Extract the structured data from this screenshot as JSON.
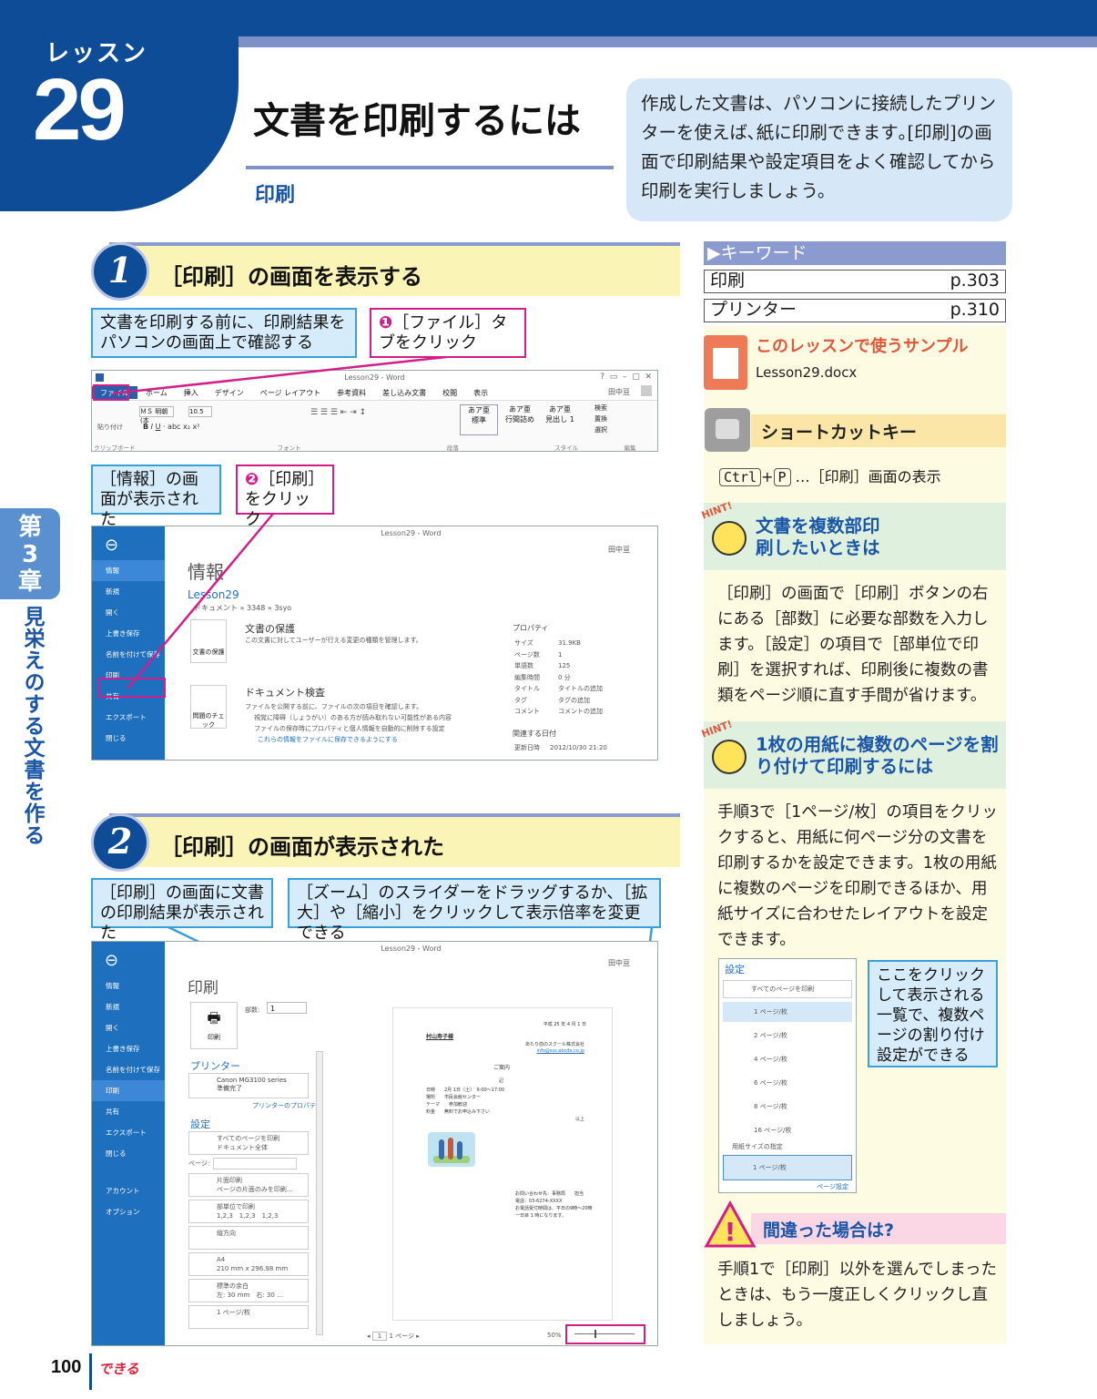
{
  "header": {
    "lesson_label": "レッスン",
    "lesson_number": "29",
    "title": "文書を印刷するには",
    "subtitle": "印刷",
    "intro": "作成した文書は、パソコンに接続したプリンターを使えば､紙に印刷できます｡[印刷]の画面で印刷結果や設定項目をよく確認してから印刷を実行しましょう。"
  },
  "chapter": {
    "tab_line1": "第",
    "tab_line2": "3",
    "tab_line3": "章",
    "title": "見栄えのする文書を作る"
  },
  "step1": {
    "number": "1",
    "title": "［印刷］の画面を表示する",
    "callout_a": "文書を印刷する前に、印刷結果をパソコンの画面上で確認する",
    "callout_b_num": "❶",
    "callout_b": "［ファイル］タブをクリック",
    "callout_c": "［情報］の画面が表示された",
    "callout_d_num": "❷",
    "callout_d": "［印刷］をクリック"
  },
  "ribbon": {
    "window_title": "Lesson29 - Word",
    "user": "田中亘",
    "tabs": [
      "ファイル",
      "ホーム",
      "挿入",
      "デザイン",
      "ページ レイアウト",
      "参考資料",
      "差し込み文書",
      "校閲",
      "表示"
    ],
    "font_name": "ＭＳ 明朝 (本",
    "font_size": "10.5",
    "paste": "貼り付け",
    "groups": [
      "クリップボード",
      "フォント",
      "段落",
      "スタイル",
      "編集"
    ],
    "styles": [
      "あア亜",
      "あア亜",
      "あア亜"
    ],
    "style_names": [
      "標準",
      "行間詰め",
      "見出し 1"
    ],
    "edit_items": [
      "検索",
      "置換",
      "選択"
    ]
  },
  "info_screen": {
    "window_title": "Lesson29 - Word",
    "user": "田中亘",
    "menu": [
      "情報",
      "新規",
      "開く",
      "上書き保存",
      "名前を付けて保存",
      "印刷",
      "共有",
      "エクスポート",
      "閉じる"
    ],
    "heading": "情報",
    "doc_name": "Lesson29",
    "path": "ドキュメント » 3348 » 3syo",
    "protect_title": "文書の保護",
    "protect_desc": "この文書に対してユーザーが行える変更の種類を管理します。",
    "protect_btn": "文書の保護",
    "inspect_title": "ドキュメント検査",
    "inspect_desc": "ファイルを公開する前に、ファイルの次の項目を確認します。",
    "inspect_item1": "視覚に障碍（しょうがい）のある方が読み取れない可能性がある内容",
    "inspect_item2": "ファイルの保存時にプロパティと個人情報を自動的に削除する設定",
    "inspect_link": "これらの情報をファイルに保存できるようにする",
    "inspect_btn": "問題のチェック",
    "props_head": "プロパティ",
    "props": [
      [
        "サイズ",
        "31.9KB"
      ],
      [
        "ページ数",
        "1"
      ],
      [
        "単語数",
        "125"
      ],
      [
        "編集時間",
        "0 分"
      ],
      [
        "タイトル",
        "タイトルの追加"
      ],
      [
        "タグ",
        "タグの追加"
      ],
      [
        "コメント",
        "コメントの追加"
      ]
    ],
    "dates_head": "関連する日付",
    "updated_label": "更新日時",
    "updated": "2012/10/30 21:20"
  },
  "step2": {
    "number": "2",
    "title": "［印刷］の画面が表示された",
    "callout_a": "［印刷］の画面に文書の印刷結果が表示された",
    "callout_b": "［ズーム］のスライダーをドラッグするか、［拡大］や［縮小］をクリックして表示倍率を変更できる"
  },
  "print_screen": {
    "window_title": "Lesson29 - Word",
    "user": "田中亘",
    "menu": [
      "情報",
      "新規",
      "開く",
      "上書き保存",
      "名前を付けて保存",
      "印刷",
      "共有",
      "エクスポート",
      "閉じる",
      "アカウント",
      "オプション"
    ],
    "heading": "印刷",
    "copies_label": "部数:",
    "copies": "1",
    "print_btn": "印刷",
    "printer_head": "プリンター",
    "printer_name": "Canon MG3100 series",
    "printer_status": "準備完了",
    "printer_props": "プリンターのプロパティ",
    "settings_head": "設定",
    "settings": [
      [
        "すべてのページを印刷",
        "ドキュメント全体"
      ],
      [
        "片面印刷",
        "ページの片面のみを印刷…"
      ],
      [
        "部単位で印刷",
        "1,2,3　1,2,3　1,2,3"
      ],
      [
        "縦方向",
        ""
      ],
      [
        "A4",
        "210 mm x 296.98 mm"
      ],
      [
        "標準の余白",
        "左: 30 mm　右: 30 …"
      ],
      [
        "1 ページ/枚",
        ""
      ]
    ],
    "pages_label": "ページ:",
    "page_nav": "1 ページ",
    "page_num": "1",
    "zoom": "50%",
    "preview": {
      "date": "平成 25 年 4 月 1 日",
      "to": "村山寿子様",
      "from_company": "あたり前のスクール株式会社",
      "from_email": "info@sss.abcde.co.jp",
      "heading": "ご案内",
      "ki": "記",
      "ijo": "以上",
      "items": [
        "日時　　2月 1日（土）　9:00～17:00",
        "場所　　市民会館センター",
        "テーマ　　参加歓迎",
        "料金　　無料でお申込み下さい"
      ],
      "footer": [
        "お問い合わせ先：事務局　　担当",
        "電話：03-6274-XXXX",
        "お電話受付時間は、平日の9時～20時",
        "一日目 1 時になります。"
      ]
    }
  },
  "sidebar": {
    "keyword_head": "▶キーワード",
    "keywords": [
      [
        "印刷",
        "p.303"
      ],
      [
        "プリンター",
        "p.310"
      ]
    ],
    "sample_head": "このレッスンで使うサンプル",
    "sample_file": "Lesson29.docx",
    "shortcut_head": "ショートカットキー",
    "key1": "Ctrl",
    "plus": "+",
    "key2": "P",
    "shortcut_desc": "…［印刷］画面の表示",
    "hint_badge": "HINT!",
    "hint1_title": "文書を複数部印刷したいときは",
    "hint1_text": "［印刷］の画面で［印刷］ボタンの右にある［部数］に必要な部数を入力します。［設定］の項目で［部単位で印刷］を選択すれば、印刷後に複数の書類をページ順に直す手間が省けます。",
    "hint2_title": "1枚の用紙に複数のページを割り付けて印刷するには",
    "hint2_text": "手順3で［1ページ/枚］の項目をクリックすると、用紙に何ページ分の文書を印刷するかを設定できます。1枚の用紙に複数のページを印刷できるほか、用紙サイズに合わせたレイアウトを設定できます。",
    "mini_head": "設定",
    "mini_first": "すべてのページを印刷",
    "mini_items": [
      "1 ページ/枚",
      "2 ページ/枚",
      "4 ページ/枚",
      "6 ページ/枚",
      "8 ページ/枚",
      "16 ページ/枚"
    ],
    "mini_paper": "用紙サイズの指定",
    "mini_selected": "1 ページ/枚",
    "mini_footer": "ページ設定",
    "mini_callout": "ここをクリックして表示される一覧で、複数ページの割り付け設定ができる",
    "mistake_title": "間違った場合は?",
    "mistake_text": "手順1で［印刷］以外を選んでしまったときは、もう一度正しくクリックし直しましょう。"
  },
  "footer": {
    "page_number": "100",
    "brand": "できる"
  },
  "colors": {
    "brand_blue": "#0f4c98",
    "accent_pink": "#d31e8a",
    "callout_blue": "#3aa0dc",
    "step_yellow": "#fbf4b7",
    "sidebar_yellow": "#fefbe3",
    "hint_green": "#dff0df"
  },
  "icons": [
    "document-icon",
    "windows-key-icon",
    "hint-bulb-icon",
    "warning-icon",
    "back-arrow-icon",
    "printer-icon",
    "lock-icon"
  ]
}
